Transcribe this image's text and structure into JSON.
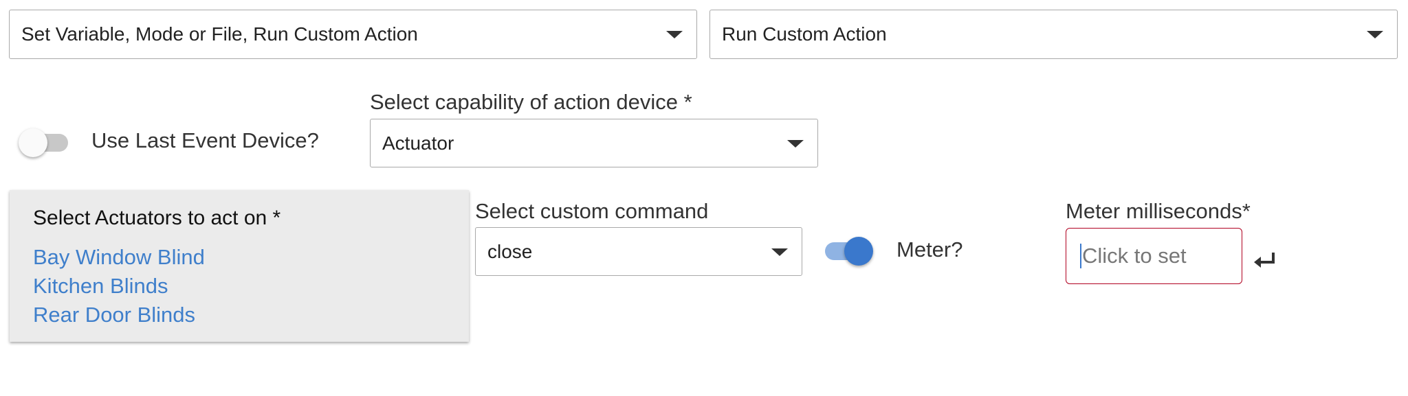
{
  "action_type_select": {
    "value": "Set Variable, Mode or File, Run Custom Action"
  },
  "action_select": {
    "value": "Run Custom Action"
  },
  "use_last_event_device": {
    "label": "Use Last Event Device?",
    "checked": false
  },
  "capability": {
    "label": "Select capability of action device *",
    "value": "Actuator"
  },
  "devices": {
    "title": "Select Actuators to act on *",
    "items": [
      "Bay Window Blind",
      "Kitchen Blinds",
      "Rear Door Blinds"
    ]
  },
  "custom_command": {
    "label": "Select custom command",
    "value": "close"
  },
  "meter": {
    "label": "Meter?",
    "checked": true
  },
  "meter_ms": {
    "label": "Meter milliseconds*",
    "placeholder": "Click to set"
  },
  "icons": {
    "caret": "caret-down-icon",
    "enter": "enter-icon"
  },
  "colors": {
    "link": "#3f7fcb",
    "toggle_on": "#3a78cc",
    "error_border": "#b00020"
  }
}
